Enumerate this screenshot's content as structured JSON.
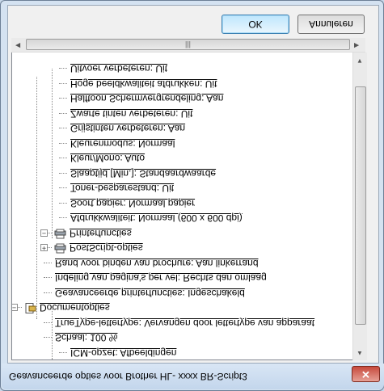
{
  "window": {
    "title": "Geavanceerde opties voor Brother HL- xxxx BR-Script3",
    "close_glyph": "✕"
  },
  "tree": {
    "items": [
      {
        "label": "ICM-opzet: Afbeeldingen",
        "indent": 3
      },
      {
        "label": "Schaal: 100 %",
        "indent": 2
      },
      {
        "label": "TrueType-lettertype: Vervangen door lettertype van apparaat",
        "indent": 2
      },
      {
        "label": "Documentopties",
        "indent": 0,
        "expander": "minus",
        "icon": "document-icon"
      },
      {
        "label": "Geavanceerde printerfuncties: Ingeschakeld",
        "indent": 2
      },
      {
        "label": "Indeling van pagina's per vel: Rechts dan omlaag",
        "indent": 2
      },
      {
        "label": "Rand voor binden van brochure: Aan linkerrand",
        "indent": 2
      },
      {
        "label": "PostScript-opties",
        "indent": 2,
        "expander": "plus",
        "icon": "printer-icon"
      },
      {
        "label": "Printerfuncties",
        "indent": 2,
        "expander": "minus",
        "icon": "printer-icon"
      },
      {
        "label": "Afdrukkwaliteit: Normaal (600 x 600 dpi)",
        "indent": 3
      },
      {
        "label": "Soort papier: Normaal papier",
        "indent": 3
      },
      {
        "label": "Toner-besparestand: Uit",
        "indent": 3
      },
      {
        "label": "Slaaptijd [Min.]: Standaardwaarde",
        "indent": 3
      },
      {
        "label": "Kleur/Mono: Auto",
        "indent": 3
      },
      {
        "label": "Kleurenmodus: Normaal",
        "indent": 3
      },
      {
        "label": "Grijstinten verbeteren: Aan",
        "indent": 3
      },
      {
        "label": "Zwarte tinten verbeteren: Uit",
        "indent": 3
      },
      {
        "label": "Halftoon Schermvergrendeling: Aan",
        "indent": 3
      },
      {
        "label": "Hoge beeldkwaliteit afdrukken: Uit",
        "indent": 3
      },
      {
        "label": "Uitvoer verbeteren: Uit",
        "indent": 3
      }
    ]
  },
  "scrollbar": {
    "grip": "|||"
  },
  "buttons": {
    "ok_label": "OK",
    "cancel_label": "Annuleren"
  },
  "colors": {
    "frame": "#d4e2f1",
    "close_button": "#c7493c",
    "default_button": "#bee6fd"
  }
}
